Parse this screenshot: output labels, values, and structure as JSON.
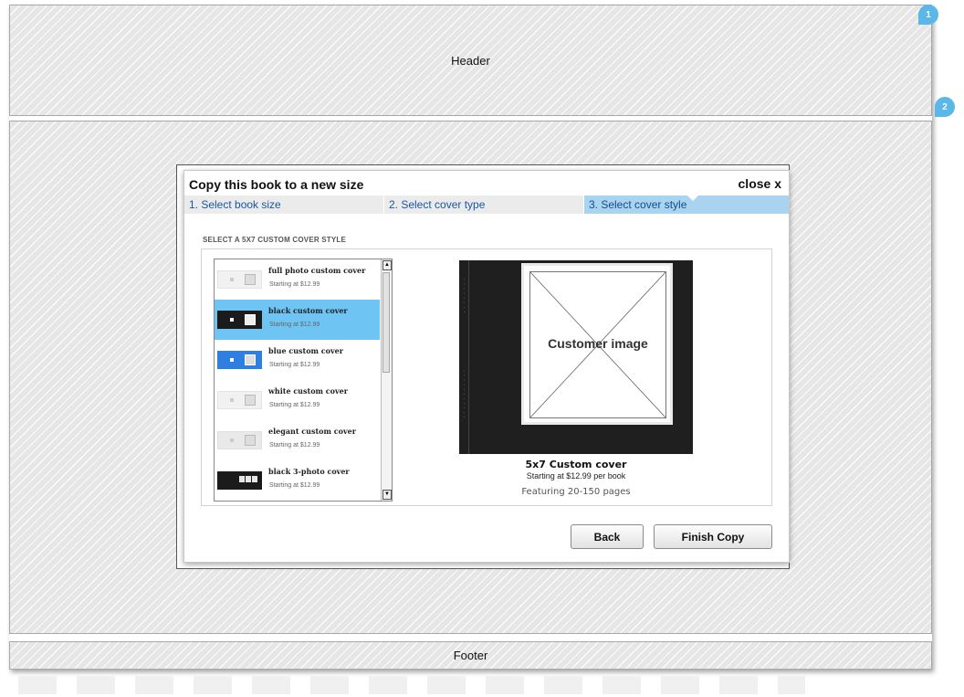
{
  "regions": {
    "header_label": "Header",
    "footer_label": "Footer"
  },
  "markers": [
    "1",
    "2"
  ],
  "dialog": {
    "title": "Copy this book to a new size",
    "close_label": "close  x",
    "steps": [
      {
        "label": "1. Select book size",
        "active": false
      },
      {
        "label": "2. Select cover type",
        "active": false
      },
      {
        "label": "3. Select cover style",
        "active": true
      }
    ],
    "section_label": "SELECT A 5X7 CUSTOM COVER STYLE",
    "cover_styles": [
      {
        "name": "full photo custom cover",
        "price": "Starting at $12.99",
        "thumb": "light",
        "selected": false
      },
      {
        "name": "black custom cover",
        "price": "Starting at $12.99",
        "thumb": "dark",
        "selected": true
      },
      {
        "name": "blue custom cover",
        "price": "Starting at $12.99",
        "thumb": "blue",
        "selected": false
      },
      {
        "name": "white custom cover",
        "price": "Starting at $12.99",
        "thumb": "light",
        "selected": false
      },
      {
        "name": "elegant custom cover",
        "price": "Starting at $12.99",
        "thumb": "grey",
        "selected": false
      },
      {
        "name": "black 3-photo cover",
        "price": "Starting at $12.99",
        "thumb": "dark3",
        "selected": false
      }
    ],
    "preview": {
      "image_label": "Customer image",
      "title": "5x7 Custom cover",
      "price": "Starting at $12.99 per book",
      "pages": "Featuring 20-150 pages"
    },
    "buttons": {
      "back": "Back",
      "finish": "Finish Copy"
    }
  },
  "colors": {
    "accent": "#6ec4f3",
    "step_active_bg": "#a9d4ef",
    "step_link": "#1a56a8",
    "marker": "#5bb7e8"
  }
}
